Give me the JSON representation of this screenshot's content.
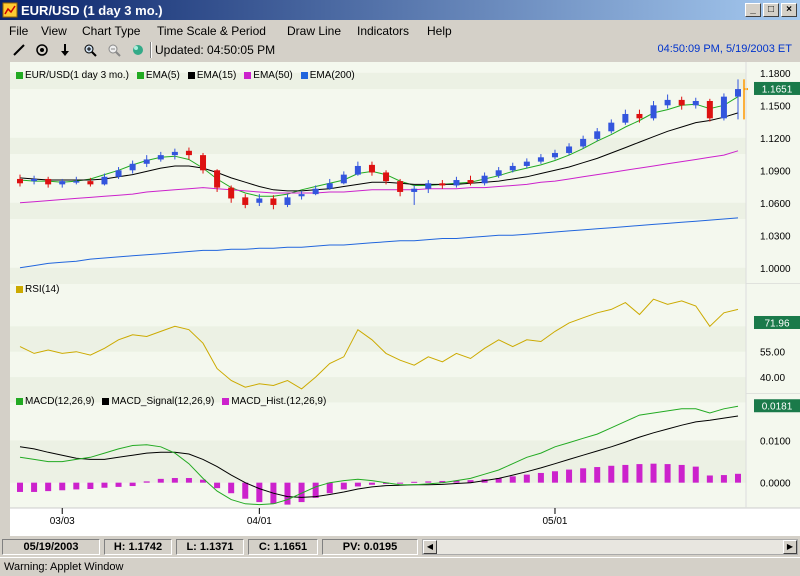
{
  "window": {
    "title": "EUR/USD (1 day  3 mo.)"
  },
  "menu": [
    "File",
    "View",
    "Chart Type",
    "Time Scale & Period",
    "Draw Line",
    "Indicators",
    "Help"
  ],
  "toolbar": {
    "updated": "Updated: 04:50:05 PM",
    "datetime": "04:50:09 PM, 5/19/2003 ET"
  },
  "colors": {
    "price_label_bg": "#1a7a4a",
    "ema5": "#22aa22",
    "ema15": "#000000",
    "ema50": "#cc22cc",
    "ema200": "#2266dd",
    "rsi": "#ccaa00",
    "macd": "#22aa22",
    "signal": "#000000",
    "hist": "#cc22cc",
    "up": "#3355dd",
    "down": "#dd1111"
  },
  "panels": {
    "price": {
      "legend": [
        "EUR/USD(1 day  3 mo.)",
        "EMA(5)",
        "EMA(15)",
        "EMA(50)",
        "EMA(200)"
      ],
      "ticks": [
        "1.1800",
        "1.1500",
        "1.1200",
        "1.0900",
        "1.0600",
        "1.0300",
        "1.0000"
      ],
      "last_label": "1.1651"
    },
    "rsi": {
      "legend": "RSI(14)",
      "ticks": [
        "55.00",
        "40.00"
      ],
      "last_label": "71.96"
    },
    "macd": {
      "legend": [
        "MACD(12,26,9)",
        "MACD_Signal(12,26,9)",
        "MACD_Hist.(12,26,9)"
      ],
      "ticks": [
        "0.0100",
        "0.0000"
      ],
      "last_label": "0.0181"
    },
    "xaxis": [
      "03/03",
      "04/01",
      "05/01"
    ]
  },
  "status": {
    "date": "05/19/2003",
    "high": "H: 1.1742",
    "low": "L: 1.1371",
    "close": "C: 1.1651",
    "pv": "PV: 0.0195"
  },
  "warning": "Warning: Applet Window",
  "chart_data": [
    {
      "type": "line",
      "title": "",
      "ylim": [
        0.985,
        1.19
      ],
      "series": [
        {
          "name": "EMA(5)",
          "values": [
            1.081,
            1.08,
            1.08,
            1.079,
            1.08,
            1.082,
            1.086,
            1.09,
            1.095,
            1.099,
            1.102,
            1.103,
            1.1,
            1.092,
            1.082,
            1.074,
            1.069,
            1.066,
            1.066,
            1.068,
            1.072,
            1.075,
            1.078,
            1.081,
            1.087,
            1.089,
            1.086,
            1.08,
            1.076,
            1.076,
            1.077,
            1.078,
            1.079,
            1.082,
            1.085,
            1.089,
            1.092,
            1.095,
            1.099,
            1.104,
            1.11,
            1.117,
            1.123,
            1.13,
            1.136,
            1.143,
            1.146,
            1.15,
            1.151,
            1.147,
            1.15,
            1.158
          ]
        },
        {
          "name": "EMA(15)",
          "values": [
            1.083,
            1.082,
            1.081,
            1.081,
            1.081,
            1.081,
            1.082,
            1.084,
            1.086,
            1.089,
            1.092,
            1.094,
            1.094,
            1.092,
            1.088,
            1.083,
            1.079,
            1.075,
            1.072,
            1.071,
            1.071,
            1.072,
            1.073,
            1.075,
            1.077,
            1.079,
            1.079,
            1.078,
            1.077,
            1.077,
            1.077,
            1.077,
            1.078,
            1.079,
            1.08,
            1.082,
            1.084,
            1.087,
            1.09,
            1.093,
            1.097,
            1.101,
            1.106,
            1.111,
            1.116,
            1.121,
            1.126,
            1.13,
            1.134,
            1.136,
            1.139,
            1.143
          ]
        },
        {
          "name": "EMA(50)",
          "values": [
            1.06,
            1.061,
            1.062,
            1.063,
            1.064,
            1.065,
            1.066,
            1.067,
            1.068,
            1.07,
            1.071,
            1.072,
            1.073,
            1.074,
            1.073,
            1.072,
            1.071,
            1.07,
            1.069,
            1.069,
            1.069,
            1.069,
            1.07,
            1.07,
            1.071,
            1.072,
            1.072,
            1.072,
            1.072,
            1.073,
            1.073,
            1.073,
            1.074,
            1.074,
            1.075,
            1.076,
            1.077,
            1.079,
            1.08,
            1.082,
            1.084,
            1.086,
            1.088,
            1.09,
            1.092,
            1.094,
            1.096,
            1.098,
            1.1,
            1.102,
            1.104,
            1.108
          ]
        },
        {
          "name": "EMA(200)",
          "values": [
            1.0,
            1.002,
            1.004,
            1.005,
            1.006,
            1.008,
            1.009,
            1.01,
            1.011,
            1.012,
            1.013,
            1.014,
            1.015,
            1.016,
            1.016,
            1.017,
            1.017,
            1.018,
            1.018,
            1.019,
            1.019,
            1.02,
            1.021,
            1.021,
            1.022,
            1.023,
            1.024,
            1.025,
            1.025,
            1.026,
            1.027,
            1.027,
            1.028,
            1.029,
            1.03,
            1.03,
            1.031,
            1.032,
            1.033,
            1.034,
            1.035,
            1.036,
            1.037,
            1.038,
            1.039,
            1.04,
            1.041,
            1.042,
            1.043,
            1.044,
            1.045,
            1.046
          ]
        }
      ],
      "candles": [
        [
          1.082,
          1.078,
          1.086,
          1.075
        ],
        [
          1.08,
          1.082,
          1.085,
          1.077
        ],
        [
          1.082,
          1.077,
          1.084,
          1.074
        ],
        [
          1.077,
          1.08,
          1.082,
          1.074
        ],
        [
          1.079,
          1.08,
          1.084,
          1.077
        ],
        [
          1.08,
          1.077,
          1.083,
          1.075
        ],
        [
          1.077,
          1.084,
          1.087,
          1.076
        ],
        [
          1.084,
          1.09,
          1.093,
          1.082
        ],
        [
          1.09,
          1.096,
          1.099,
          1.087
        ],
        [
          1.096,
          1.1,
          1.104,
          1.093
        ],
        [
          1.1,
          1.104,
          1.107,
          1.098
        ],
        [
          1.104,
          1.107,
          1.11,
          1.1
        ],
        [
          1.108,
          1.104,
          1.111,
          1.1
        ],
        [
          1.104,
          1.09,
          1.106,
          1.087
        ],
        [
          1.09,
          1.074,
          1.091,
          1.07
        ],
        [
          1.074,
          1.064,
          1.076,
          1.06
        ],
        [
          1.065,
          1.058,
          1.068,
          1.055
        ],
        [
          1.06,
          1.064,
          1.068,
          1.057
        ],
        [
          1.064,
          1.058,
          1.067,
          1.054
        ],
        [
          1.058,
          1.065,
          1.068,
          1.056
        ],
        [
          1.066,
          1.068,
          1.071,
          1.063
        ],
        [
          1.068,
          1.073,
          1.076,
          1.067
        ],
        [
          1.073,
          1.078,
          1.082,
          1.072
        ],
        [
          1.078,
          1.086,
          1.089,
          1.077
        ],
        [
          1.086,
          1.094,
          1.098,
          1.085
        ],
        [
          1.095,
          1.088,
          1.098,
          1.085
        ],
        [
          1.088,
          1.08,
          1.09,
          1.077
        ],
        [
          1.08,
          1.07,
          1.082,
          1.066
        ],
        [
          1.07,
          1.073,
          1.076,
          1.058
        ],
        [
          1.073,
          1.078,
          1.081,
          1.069
        ],
        [
          1.078,
          1.076,
          1.081,
          1.073
        ],
        [
          1.076,
          1.081,
          1.084,
          1.074
        ],
        [
          1.081,
          1.078,
          1.085,
          1.076
        ],
        [
          1.078,
          1.085,
          1.088,
          1.076
        ],
        [
          1.085,
          1.09,
          1.093,
          1.083
        ],
        [
          1.09,
          1.094,
          1.097,
          1.088
        ],
        [
          1.094,
          1.098,
          1.101,
          1.092
        ],
        [
          1.098,
          1.102,
          1.105,
          1.096
        ],
        [
          1.102,
          1.106,
          1.109,
          1.1
        ],
        [
          1.106,
          1.112,
          1.115,
          1.104
        ],
        [
          1.112,
          1.119,
          1.122,
          1.11
        ],
        [
          1.119,
          1.126,
          1.129,
          1.117
        ],
        [
          1.126,
          1.134,
          1.137,
          1.124
        ],
        [
          1.134,
          1.142,
          1.146,
          1.132
        ],
        [
          1.142,
          1.138,
          1.146,
          1.134
        ],
        [
          1.138,
          1.15,
          1.154,
          1.136
        ],
        [
          1.15,
          1.155,
          1.16,
          1.147
        ],
        [
          1.155,
          1.15,
          1.158,
          1.146
        ],
        [
          1.15,
          1.154,
          1.157,
          1.147
        ],
        [
          1.154,
          1.138,
          1.156,
          1.135
        ],
        [
          1.138,
          1.158,
          1.161,
          1.136
        ],
        [
          1.158,
          1.165,
          1.174,
          1.137
        ]
      ]
    },
    {
      "type": "line",
      "title": "",
      "ylim": [
        30,
        95
      ],
      "series": [
        {
          "name": "RSI(14)",
          "values": [
            58,
            54,
            56,
            54,
            55,
            53,
            57,
            62,
            65,
            64,
            67,
            70,
            68,
            60,
            45,
            38,
            34,
            36,
            35,
            38,
            33,
            40,
            48,
            52,
            68,
            62,
            54,
            50,
            47,
            52,
            49,
            54,
            51,
            57,
            62,
            58,
            62,
            61,
            67,
            72,
            75,
            78,
            80,
            84,
            77,
            86,
            83,
            85,
            82,
            70,
            78,
            80
          ]
        }
      ]
    },
    {
      "type": "line",
      "title": "",
      "ylim": [
        -0.006,
        0.021
      ],
      "series": [
        {
          "name": "MACD(12,26,9)",
          "values": [
            0.006,
            0.0055,
            0.005,
            0.005,
            0.0055,
            0.006,
            0.007,
            0.008,
            0.0088,
            0.009,
            0.0085,
            0.007,
            0.0045,
            0.001,
            -0.002,
            -0.004,
            -0.005,
            -0.0052,
            -0.005,
            -0.004,
            -0.0025,
            -0.001,
            0.0,
            0.0005,
            0.0008,
            0.0005,
            0.0,
            -0.0005,
            -0.0005,
            -0.0003,
            0.0,
            0.0005,
            0.001,
            0.002,
            0.003,
            0.0045,
            0.006,
            0.007,
            0.0085,
            0.0095,
            0.0105,
            0.0115,
            0.013,
            0.0145,
            0.016,
            0.0165,
            0.017,
            0.0175,
            0.0175,
            0.0165,
            0.0175,
            0.0181
          ]
        },
        {
          "name": "MACD_Signal(12,26,9)",
          "values": [
            0.0085,
            0.008,
            0.0072,
            0.0065,
            0.0058,
            0.0055,
            0.0055,
            0.006,
            0.0065,
            0.007,
            0.0072,
            0.0072,
            0.0068,
            0.0055,
            0.0038,
            0.0018,
            0.0,
            -0.0014,
            -0.0025,
            -0.0033,
            -0.0035,
            -0.0033,
            -0.0028,
            -0.0022,
            -0.0015,
            -0.001,
            -0.0007,
            -0.0006,
            -0.0005,
            -0.0005,
            -0.0004,
            -0.0002,
            0.0,
            0.0005,
            0.001,
            0.0018,
            0.0026,
            0.0035,
            0.0045,
            0.0055,
            0.0065,
            0.0075,
            0.0085,
            0.0096,
            0.0108,
            0.0118,
            0.0127,
            0.0136,
            0.0144,
            0.0148,
            0.0153,
            0.0158
          ]
        },
        {
          "name": "MACD_Hist.(12,26,9)",
          "type": "bar",
          "values": [
            -0.0022,
            -0.0022,
            -0.002,
            -0.0018,
            -0.0016,
            -0.0015,
            -0.0012,
            -0.001,
            -0.0008,
            0.0003,
            0.0009,
            0.0011,
            0.0011,
            0.0007,
            -0.0013,
            -0.0025,
            -0.0038,
            -0.0046,
            -0.005,
            -0.0052,
            -0.0046,
            -0.0036,
            -0.0025,
            -0.0016,
            -0.0009,
            -0.0005,
            -0.0003,
            0.0,
            0.0002,
            0.0003,
            0.0004,
            0.0005,
            0.0006,
            0.0008,
            0.0011,
            0.0015,
            0.0019,
            0.0023,
            0.0027,
            0.0031,
            0.0034,
            0.0037,
            0.004,
            0.0042,
            0.0044,
            0.0045,
            0.0044,
            0.0042,
            0.0038,
            0.0017,
            0.0018,
            0.0021
          ]
        }
      ]
    }
  ]
}
